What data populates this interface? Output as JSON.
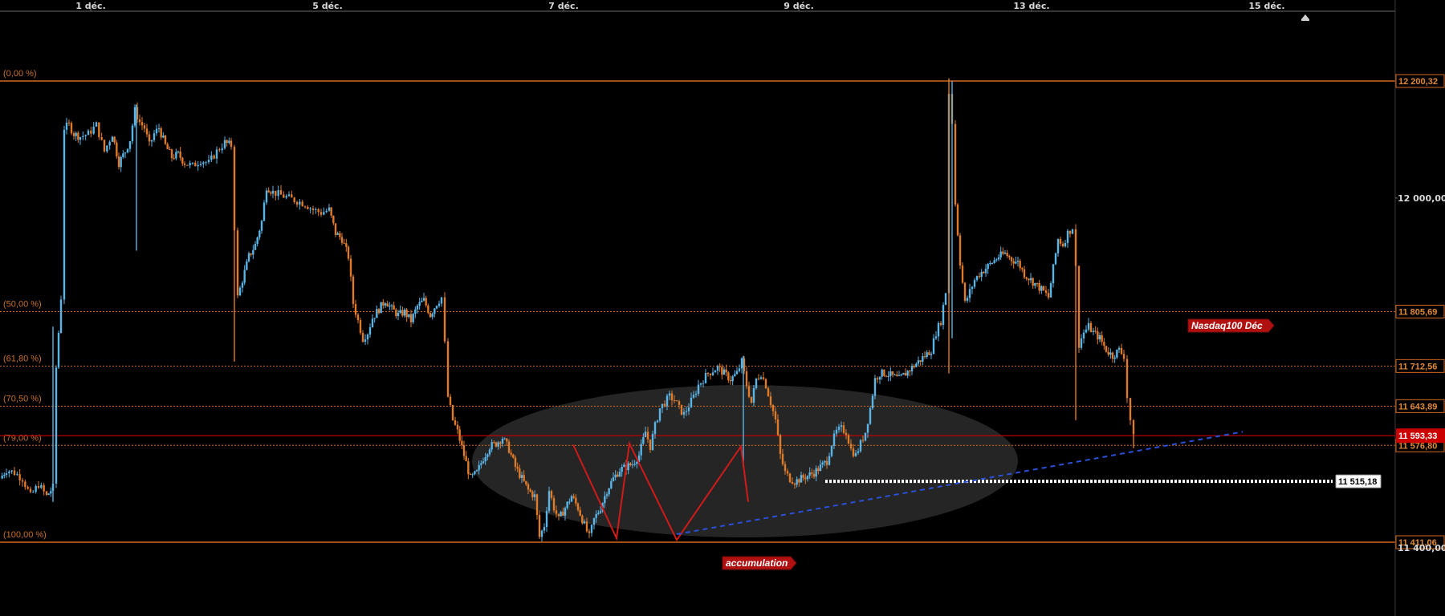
{
  "chart_data": {
    "type": "candlestick",
    "instrument_label": "Nasdaq100 Déc",
    "x_ticks": [
      "1 déc.",
      "5 déc.",
      "7 déc.",
      "9 déc.",
      "13 déc.",
      "15 déc."
    ],
    "y_ticks": [
      "12 000,00",
      "11 400,00"
    ],
    "ylim": [
      11330,
      12395
    ],
    "colors": {
      "up": "#5ab4e6",
      "down": "#e07b2a",
      "fib": "#d2691e",
      "current": "#cc0000",
      "trendline": "#2a4fd8",
      "pattern": "#d11a1a"
    },
    "fib_levels": [
      {
        "label": "(0,00 %)",
        "price": 12200.32,
        "tag": "12 200,32",
        "style": "solid"
      },
      {
        "label": "(50,00 %)",
        "price": 11805.69,
        "tag": "11 805,69",
        "style": "dotted"
      },
      {
        "label": "(61,80 %)",
        "price": 11712.56,
        "tag": "11 712,56",
        "style": "dotted"
      },
      {
        "label": "(70,50 %)",
        "price": 11643.89,
        "tag": "11 643,89",
        "style": "dotted"
      },
      {
        "label": "(79,00 %)",
        "price": 11576.8,
        "tag": "11 576,80",
        "style": "dotted"
      },
      {
        "label": "(100,00 %)",
        "price": 11411.06,
        "tag": "11 411,06",
        "style": "solid"
      }
    ],
    "current_price": {
      "price": 11593.33,
      "tag": "11 593,33"
    },
    "support": {
      "price": 11515.18,
      "tag": "11 515,18"
    },
    "annotations": {
      "pattern": "accumulation",
      "instrument": "Nasdaq100 Déc"
    },
    "candle_path": [
      [
        0,
        11520
      ],
      [
        8,
        11535
      ],
      [
        18,
        11530
      ],
      [
        28,
        11520
      ],
      [
        38,
        11490
      ],
      [
        48,
        11510
      ],
      [
        58,
        11490
      ],
      [
        66,
        11505
      ],
      [
        70,
        11710
      ],
      [
        76,
        11830
      ],
      [
        80,
        12120
      ],
      [
        86,
        12125
      ],
      [
        92,
        12110
      ],
      [
        100,
        12105
      ],
      [
        110,
        12110
      ],
      [
        120,
        12125
      ],
      [
        130,
        12080
      ],
      [
        140,
        12110
      ],
      [
        148,
        12060
      ],
      [
        156,
        12080
      ],
      [
        162,
        12100
      ],
      [
        168,
        12150
      ],
      [
        174,
        12130
      ],
      [
        180,
        12120
      ],
      [
        186,
        12090
      ],
      [
        192,
        12110
      ],
      [
        198,
        12120
      ],
      [
        206,
        12090
      ],
      [
        214,
        12070
      ],
      [
        222,
        12075
      ],
      [
        230,
        12060
      ],
      [
        240,
        12055
      ],
      [
        250,
        12065
      ],
      [
        260,
        12060
      ],
      [
        270,
        12080
      ],
      [
        280,
        12095
      ],
      [
        288,
        12090
      ],
      [
        292,
        11950
      ],
      [
        296,
        11830
      ],
      [
        302,
        11860
      ],
      [
        310,
        11900
      ],
      [
        318,
        11920
      ],
      [
        326,
        11960
      ],
      [
        332,
        12020
      ],
      [
        340,
        12010
      ],
      [
        350,
        12005
      ],
      [
        360,
        12000
      ],
      [
        370,
        11995
      ],
      [
        380,
        11990
      ],
      [
        390,
        11980
      ],
      [
        400,
        11975
      ],
      [
        410,
        11980
      ],
      [
        418,
        11940
      ],
      [
        426,
        11930
      ],
      [
        434,
        11900
      ],
      [
        440,
        11820
      ],
      [
        446,
        11790
      ],
      [
        452,
        11760
      ],
      [
        458,
        11770
      ],
      [
        464,
        11795
      ],
      [
        472,
        11810
      ],
      [
        480,
        11825
      ],
      [
        488,
        11810
      ],
      [
        496,
        11800
      ],
      [
        504,
        11805
      ],
      [
        512,
        11790
      ],
      [
        520,
        11815
      ],
      [
        528,
        11825
      ],
      [
        536,
        11800
      ],
      [
        544,
        11820
      ],
      [
        550,
        11830
      ],
      [
        554,
        11750
      ],
      [
        558,
        11660
      ],
      [
        564,
        11620
      ],
      [
        570,
        11600
      ],
      [
        578,
        11560
      ],
      [
        586,
        11520
      ],
      [
        594,
        11530
      ],
      [
        602,
        11555
      ],
      [
        610,
        11575
      ],
      [
        618,
        11580
      ],
      [
        626,
        11590
      ],
      [
        634,
        11570
      ],
      [
        642,
        11540
      ],
      [
        650,
        11520
      ],
      [
        658,
        11500
      ],
      [
        666,
        11490
      ],
      [
        672,
        11420
      ],
      [
        678,
        11440
      ],
      [
        684,
        11500
      ],
      [
        690,
        11470
      ],
      [
        696,
        11450
      ],
      [
        704,
        11470
      ],
      [
        712,
        11490
      ],
      [
        720,
        11470
      ],
      [
        728,
        11440
      ],
      [
        734,
        11420
      ],
      [
        740,
        11450
      ],
      [
        748,
        11470
      ],
      [
        756,
        11500
      ],
      [
        764,
        11520
      ],
      [
        772,
        11535
      ],
      [
        780,
        11540
      ],
      [
        788,
        11545
      ],
      [
        796,
        11560
      ],
      [
        804,
        11600
      ],
      [
        810,
        11575
      ],
      [
        816,
        11610
      ],
      [
        822,
        11640
      ],
      [
        828,
        11650
      ],
      [
        834,
        11660
      ],
      [
        840,
        11655
      ],
      [
        846,
        11640
      ],
      [
        852,
        11630
      ],
      [
        858,
        11645
      ],
      [
        864,
        11660
      ],
      [
        870,
        11680
      ],
      [
        876,
        11690
      ],
      [
        882,
        11700
      ],
      [
        888,
        11705
      ],
      [
        894,
        11710
      ],
      [
        902,
        11700
      ],
      [
        910,
        11690
      ],
      [
        918,
        11700
      ],
      [
        924,
        11720
      ],
      [
        930,
        11680
      ],
      [
        936,
        11650
      ],
      [
        942,
        11690
      ],
      [
        948,
        11700
      ],
      [
        954,
        11680
      ],
      [
        960,
        11650
      ],
      [
        966,
        11620
      ],
      [
        972,
        11560
      ],
      [
        978,
        11530
      ],
      [
        984,
        11520
      ],
      [
        990,
        11515
      ],
      [
        998,
        11520
      ],
      [
        1006,
        11525
      ],
      [
        1014,
        11530
      ],
      [
        1022,
        11540
      ],
      [
        1030,
        11550
      ],
      [
        1036,
        11580
      ],
      [
        1042,
        11600
      ],
      [
        1048,
        11605
      ],
      [
        1054,
        11600
      ],
      [
        1060,
        11570
      ],
      [
        1066,
        11560
      ],
      [
        1072,
        11580
      ],
      [
        1078,
        11600
      ],
      [
        1084,
        11640
      ],
      [
        1090,
        11690
      ],
      [
        1096,
        11700
      ],
      [
        1104,
        11700
      ],
      [
        1112,
        11695
      ],
      [
        1120,
        11690
      ],
      [
        1128,
        11700
      ],
      [
        1136,
        11710
      ],
      [
        1144,
        11720
      ],
      [
        1152,
        11730
      ],
      [
        1160,
        11740
      ],
      [
        1166,
        11770
      ],
      [
        1172,
        11790
      ],
      [
        1178,
        11840
      ],
      [
        1182,
        12180
      ],
      [
        1186,
        12130
      ],
      [
        1190,
        11990
      ],
      [
        1196,
        11890
      ],
      [
        1202,
        11820
      ],
      [
        1208,
        11840
      ],
      [
        1214,
        11860
      ],
      [
        1220,
        11870
      ],
      [
        1228,
        11880
      ],
      [
        1236,
        11890
      ],
      [
        1244,
        11900
      ],
      [
        1252,
        11905
      ],
      [
        1260,
        11895
      ],
      [
        1268,
        11890
      ],
      [
        1276,
        11870
      ],
      [
        1284,
        11860
      ],
      [
        1292,
        11850
      ],
      [
        1300,
        11840
      ],
      [
        1306,
        11830
      ],
      [
        1312,
        11880
      ],
      [
        1318,
        11930
      ],
      [
        1324,
        11920
      ],
      [
        1330,
        11940
      ],
      [
        1336,
        11950
      ],
      [
        1340,
        11880
      ],
      [
        1344,
        11750
      ],
      [
        1350,
        11770
      ],
      [
        1356,
        11780
      ],
      [
        1362,
        11770
      ],
      [
        1370,
        11760
      ],
      [
        1378,
        11740
      ],
      [
        1386,
        11730
      ],
      [
        1394,
        11740
      ],
      [
        1400,
        11730
      ],
      [
        1404,
        11660
      ],
      [
        1408,
        11620
      ],
      [
        1412,
        11590
      ]
    ]
  }
}
